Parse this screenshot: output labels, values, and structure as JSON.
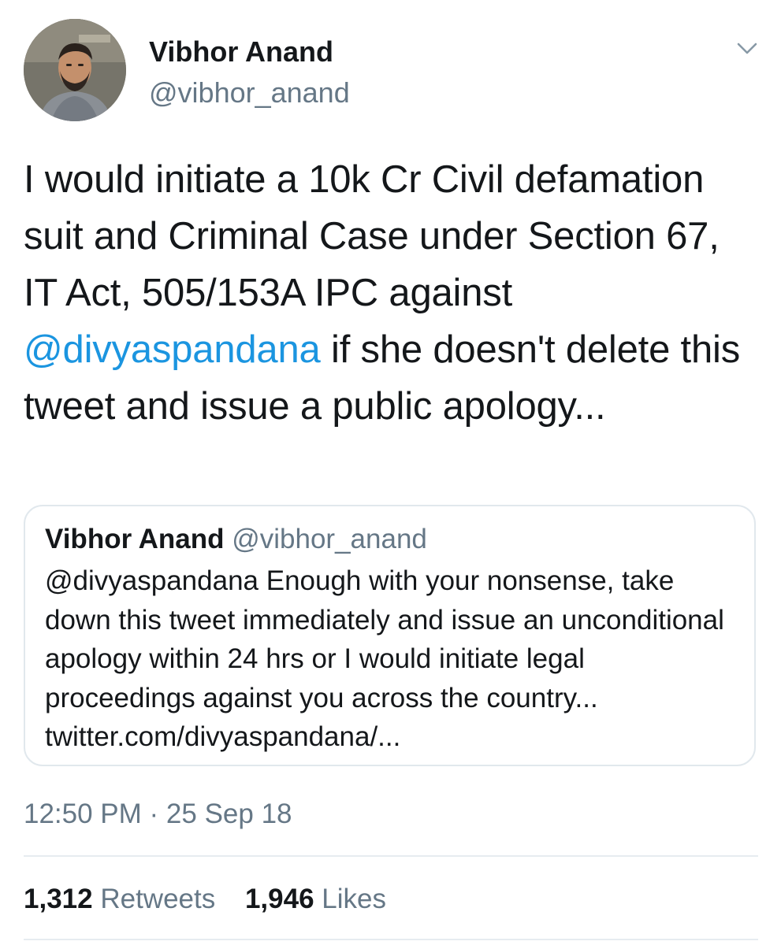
{
  "author": {
    "name": "Vibhor Anand",
    "handle": "@vibhor_anand"
  },
  "tweet": {
    "text_before": "I would initiate a 10k Cr Civil defamation suit and Criminal Case under Section 67, IT Act, 505/153A IPC against ",
    "mention": "@divyaspandana",
    "text_after": " if she doesn't delete this tweet and issue a public apology..."
  },
  "quoted_tweet": {
    "name": "Vibhor Anand",
    "handle": "@vibhor_anand",
    "text": "@divyaspandana Enough with your nonsense, take down this tweet immediately and issue an unconditional apology within 24 hrs or I would initiate legal proceedings against you across the country... twitter.com/divyaspandana/..."
  },
  "timestamp": "12:50 PM · 25 Sep 18",
  "stats": {
    "retweets_count": "1,312",
    "retweets_label": "Retweets",
    "likes_count": "1,946",
    "likes_label": "Likes"
  },
  "icons": {
    "menu": "chevron-down-icon"
  },
  "colors": {
    "link": "#1b95e0",
    "secondary_text": "#657786",
    "primary_text": "#14171a",
    "border": "#e1e8ed"
  }
}
